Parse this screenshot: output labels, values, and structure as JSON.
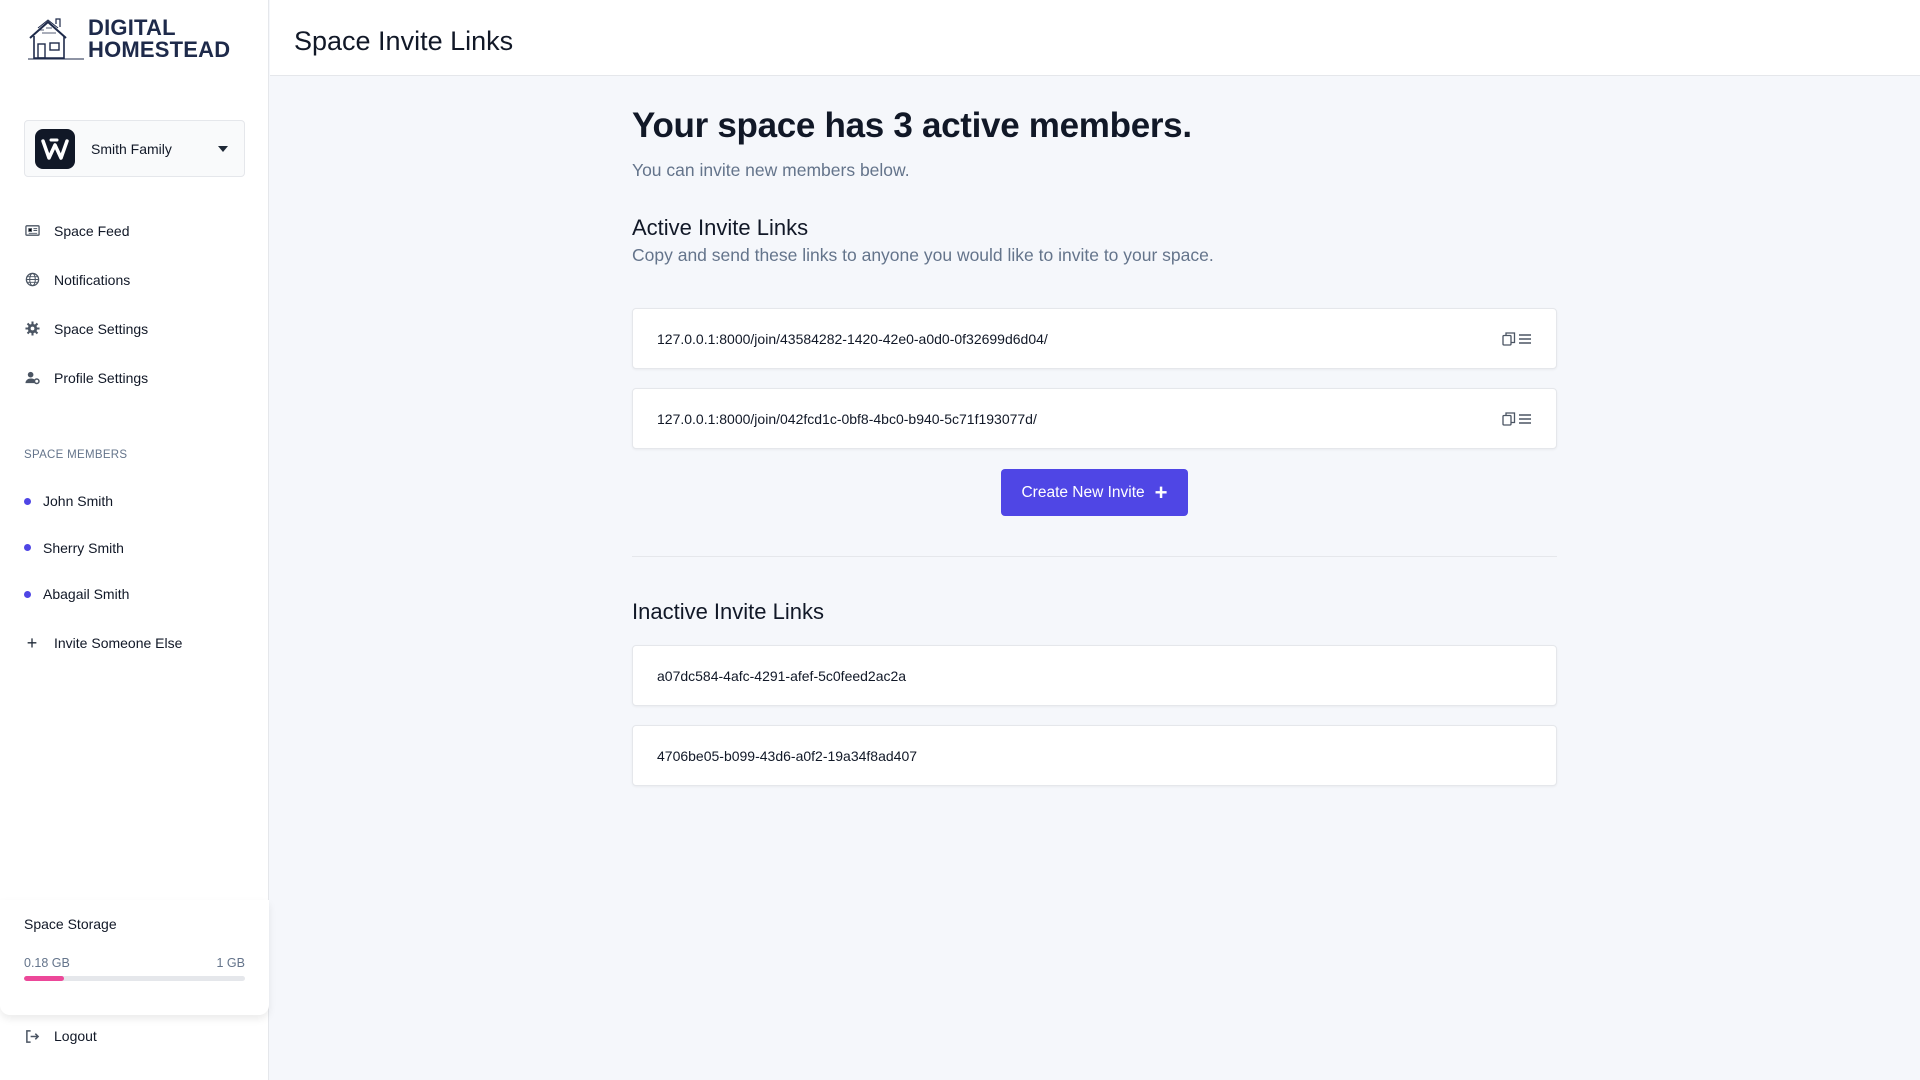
{
  "brand": {
    "line1": "DIGITAL",
    "line2": "HOMESTEAD"
  },
  "space_selector": {
    "name": "Smith Family"
  },
  "nav": [
    {
      "label": "Space Feed",
      "icon": "newspaper-icon"
    },
    {
      "label": "Notifications",
      "icon": "globe-icon"
    },
    {
      "label": "Space Settings",
      "icon": "gear-icon"
    },
    {
      "label": "Profile Settings",
      "icon": "user-gear-icon"
    }
  ],
  "members": {
    "heading": "SPACE MEMBERS",
    "list": [
      "John Smith",
      "Sherry Smith",
      "Abagail Smith"
    ],
    "invite_label": "Invite Someone Else"
  },
  "storage": {
    "title": "Space Storage",
    "used": "0.18 GB",
    "total": "1 GB",
    "used_fraction": 0.18,
    "bar_color": "#ec4899"
  },
  "logout_label": "Logout",
  "header": {
    "title": "Space Invite Links"
  },
  "main": {
    "hero": "Your space has 3 active members.",
    "hero_sub": "You can invite new members below.",
    "active": {
      "title": "Active Invite Links",
      "subtitle": "Copy and send these links to anyone you would like to invite to your space.",
      "links": [
        "127.0.0.1:8000/join/43584282-1420-42e0-a0d0-0f32699d6d04/",
        "127.0.0.1:8000/join/042fcd1c-0bf8-4bc0-b940-5c71f193077d/"
      ]
    },
    "create_button": "Create New Invite",
    "inactive": {
      "title": "Inactive Invite Links",
      "links": [
        "a07dc584-4afc-4291-afef-5c0feed2ac2a",
        "4706be05-b099-43d6-a0f2-19a34f8ad407"
      ]
    }
  },
  "colors": {
    "accent": "#4f46e5",
    "storage_bar": "#ec4899"
  }
}
